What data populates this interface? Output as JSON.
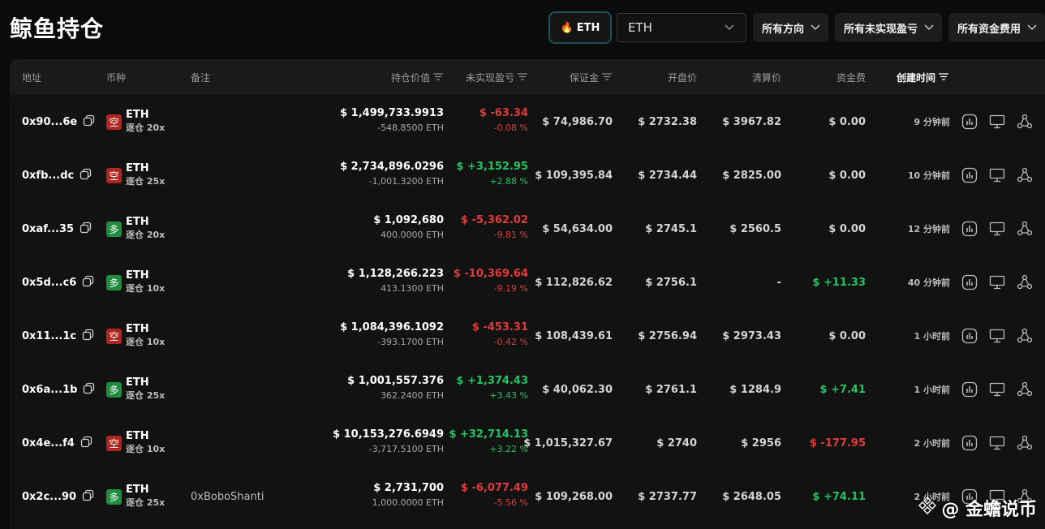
{
  "page": {
    "title": "鲸鱼持仓"
  },
  "filters": {
    "coin_chip": "ETH",
    "coin_select": "ETH",
    "direction": "所有方向",
    "pnl": "所有未实现盈亏",
    "funding": "所有资金费用"
  },
  "table": {
    "headers": {
      "address": "地址",
      "coin": "币种",
      "note": "备注",
      "value": "持仓价值",
      "upnl": "未实现盈亏",
      "margin": "保证金",
      "entry": "开盘价",
      "liq": "清算价",
      "funding": "资金费",
      "created": "创建时间"
    },
    "rows": [
      {
        "address": "0x90...6e",
        "side": "空",
        "side_type": "short",
        "coin": "ETH",
        "leverage": "逐仓 20x",
        "note": "",
        "value": "$ 1,499,733.9913",
        "size": "-548.8500 ETH",
        "pnl": "$ -63.34",
        "pnl_pct": "-0.08 %",
        "pnl_sign": "neg",
        "margin": "$ 74,986.70",
        "entry": "$ 2732.38",
        "liq": "$ 3967.82",
        "funding": "$ 0.00",
        "funding_sign": "zero",
        "created": "9 分钟前"
      },
      {
        "address": "0xfb...dc",
        "side": "空",
        "side_type": "short",
        "coin": "ETH",
        "leverage": "逐仓 25x",
        "note": "",
        "value": "$ 2,734,896.0296",
        "size": "-1,001.3200 ETH",
        "pnl": "$ +3,152.95",
        "pnl_pct": "+2.88 %",
        "pnl_sign": "pos",
        "margin": "$ 109,395.84",
        "entry": "$ 2734.44",
        "liq": "$ 2825.00",
        "funding": "$ 0.00",
        "funding_sign": "zero",
        "created": "10 分钟前"
      },
      {
        "address": "0xaf...35",
        "side": "多",
        "side_type": "long",
        "coin": "ETH",
        "leverage": "逐仓 20x",
        "note": "",
        "value": "$ 1,092,680",
        "size": "400.0000 ETH",
        "pnl": "$ -5,362.02",
        "pnl_pct": "-9.81 %",
        "pnl_sign": "neg",
        "margin": "$ 54,634.00",
        "entry": "$ 2745.1",
        "liq": "$ 2560.5",
        "funding": "$ 0.00",
        "funding_sign": "zero",
        "created": "12 分钟前"
      },
      {
        "address": "0x5d...c6",
        "side": "多",
        "side_type": "long",
        "coin": "ETH",
        "leverage": "逐仓 10x",
        "note": "",
        "value": "$ 1,128,266.223",
        "size": "413.1300 ETH",
        "pnl": "$ -10,369.64",
        "pnl_pct": "-9.19 %",
        "pnl_sign": "neg",
        "margin": "$ 112,826.62",
        "entry": "$ 2756.1",
        "liq": "-",
        "funding": "$ +11.33",
        "funding_sign": "pos",
        "created": "40 分钟前"
      },
      {
        "address": "0x11...1c",
        "side": "空",
        "side_type": "short",
        "coin": "ETH",
        "leverage": "逐仓 10x",
        "note": "",
        "value": "$ 1,084,396.1092",
        "size": "-393.1700 ETH",
        "pnl": "$ -453.31",
        "pnl_pct": "-0.42 %",
        "pnl_sign": "neg",
        "margin": "$ 108,439.61",
        "entry": "$ 2756.94",
        "liq": "$ 2973.43",
        "funding": "$ 0.00",
        "funding_sign": "zero",
        "created": "1 小时前"
      },
      {
        "address": "0x6a...1b",
        "side": "多",
        "side_type": "long",
        "coin": "ETH",
        "leverage": "逐仓 25x",
        "note": "",
        "value": "$ 1,001,557.376",
        "size": "362.2400 ETH",
        "pnl": "$ +1,374.43",
        "pnl_pct": "+3.43 %",
        "pnl_sign": "pos",
        "margin": "$ 40,062.30",
        "entry": "$ 2761.1",
        "liq": "$ 1284.9",
        "funding": "$ +7.41",
        "funding_sign": "pos",
        "created": "1 小时前"
      },
      {
        "address": "0x4e...f4",
        "side": "空",
        "side_type": "short",
        "coin": "ETH",
        "leverage": "逐仓 10x",
        "note": "",
        "value": "$ 10,153,276.6949",
        "size": "-3,717.5100 ETH",
        "pnl": "$ +32,714.13",
        "pnl_pct": "+3.22 %",
        "pnl_sign": "pos",
        "margin": "$ 1,015,327.67",
        "entry": "$ 2740",
        "liq": "$ 2956",
        "funding": "$ -177.95",
        "funding_sign": "neg",
        "created": "2 小时前"
      },
      {
        "address": "0x2c...90",
        "side": "多",
        "side_type": "long",
        "coin": "ETH",
        "leverage": "逐仓 25x",
        "note": "0xBoboShanti",
        "value": "$ 2,731,700",
        "size": "1,000.0000 ETH",
        "pnl": "$ -6,077.49",
        "pnl_pct": "-5.56 %",
        "pnl_sign": "neg",
        "margin": "$ 109,268.00",
        "entry": "$ 2737.77",
        "liq": "$ 2648.05",
        "funding": "$ +74.11",
        "funding_sign": "pos",
        "created": "2 小时前"
      }
    ]
  },
  "icons": {
    "chip": "flame-icon",
    "dropdown": "chevron-down-icon",
    "sort": "sort-icon",
    "copy": "copy-icon",
    "actions": [
      "chart-icon",
      "monitor-icon",
      "share-icon"
    ]
  },
  "colors": {
    "positive": "#22c55e",
    "negative": "#e23b3b",
    "short_badge": "#b0261f",
    "long_badge": "#1e8e3e"
  },
  "watermark": {
    "text": "@ 金蟾说币"
  }
}
